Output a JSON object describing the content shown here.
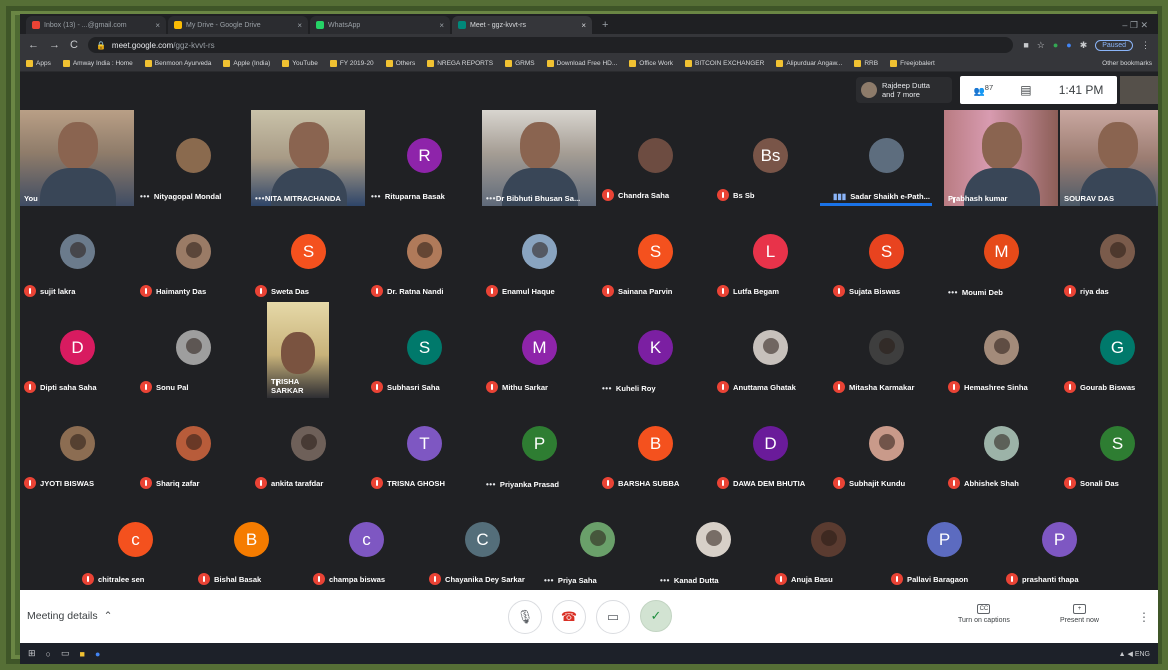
{
  "browser": {
    "tabs": [
      {
        "label": "Inbox (13) - ...@gmail.com",
        "color": "#ea4335"
      },
      {
        "label": "My Drive - Google Drive",
        "color": "#fbbc04"
      },
      {
        "label": "WhatsApp",
        "color": "#25d366"
      },
      {
        "label": "Meet - ggz-kvvt-rs",
        "color": "#00897b"
      }
    ],
    "url_host": "meet.google.com",
    "url_path": "/ggz-kvvt-rs",
    "profile_state": "Paused",
    "bookmarks": [
      "Apps",
      "Amway India : Home",
      "Benmoon Ayurveda",
      "Apple (India)",
      "YouTube",
      "FY 2019-20",
      "Others",
      "NREGA REPORTS",
      "GRMS",
      "Download Free HD...",
      "Office Work",
      "BITCOIN EXCHANGER",
      "Alipurduar Angaw...",
      "RRB",
      "Freejobalert"
    ],
    "other_bookmarks": "Other bookmarks"
  },
  "meet": {
    "presenter_line1": "Rajdeep Dutta",
    "presenter_line2": "and 7 more",
    "participant_count": "87",
    "time": "1:41 PM",
    "meeting_details_label": "Meeting details",
    "captions_label": "Turn on captions",
    "present_label": "Present now"
  },
  "participants_video_row": [
    {
      "name": "You",
      "status": "none"
    },
    {
      "name": "Nityagopal Mondal",
      "status": "dots",
      "avatar_letter": "",
      "avatar_color": "#8a6a4e"
    },
    {
      "name": "NITA MITRACHANDA",
      "status": "dots"
    },
    {
      "name": "Rituparna Basak",
      "status": "dots",
      "avatar_letter": "R",
      "avatar_color": "#8e24aa"
    },
    {
      "name": "Dr Bibhuti Bhusan Sa...",
      "status": "dots"
    },
    {
      "name": "Chandra Saha",
      "status": "muted",
      "avatar_letter": "",
      "avatar_color": "#6d4c41"
    },
    {
      "name": "Bs Sb",
      "status": "muted",
      "avatar_letter": "Bs",
      "avatar_color": "#795548"
    },
    {
      "name": "Sadar Shaikh e-Path...",
      "status": "speaking",
      "avatar_letter": "",
      "avatar_color": "#5d6d7e"
    },
    {
      "name": "Prabhash kumar",
      "status": "muted"
    },
    {
      "name": "SOURAV DAS",
      "status": "none"
    }
  ],
  "participants_rows": [
    [
      {
        "name": "sujit lakra",
        "status": "muted",
        "letter": "",
        "color": "#6b7b8c"
      },
      {
        "name": "Haimanty Das",
        "status": "muted",
        "letter": "",
        "color": "#9a7b66"
      },
      {
        "name": "Sweta Das",
        "status": "muted",
        "letter": "S",
        "color": "#f4511e"
      },
      {
        "name": "Dr. Ratna Nandi",
        "status": "muted",
        "letter": "",
        "color": "#b07a5a"
      },
      {
        "name": "Enamul Haque",
        "status": "muted",
        "letter": "",
        "color": "#89a4c0"
      },
      {
        "name": "Sainana Parvin",
        "status": "muted",
        "letter": "S",
        "color": "#f4511e"
      },
      {
        "name": "Lutfa Begam",
        "status": "muted",
        "letter": "L",
        "color": "#e8334a"
      },
      {
        "name": "Sujata Biswas",
        "status": "muted",
        "letter": "S",
        "color": "#e8431f"
      },
      {
        "name": "Moumi Deb",
        "status": "dots",
        "letter": "M",
        "color": "#e64a19"
      },
      {
        "name": "riya das",
        "status": "muted",
        "letter": "",
        "color": "#7a5b4b"
      }
    ],
    [
      {
        "name": "Dipti saha Saha",
        "status": "muted",
        "letter": "D",
        "color": "#d81b60"
      },
      {
        "name": "Sonu Pal",
        "status": "muted",
        "letter": "",
        "color": "#9e9e9e"
      },
      {
        "name": "TRISHA SARKAR",
        "status": "muted",
        "letter": "",
        "color": "#a08a6a"
      },
      {
        "name": "Subhasri Saha",
        "status": "muted",
        "letter": "S",
        "color": "#00796b"
      },
      {
        "name": "Mithu Sarkar",
        "status": "muted",
        "letter": "M",
        "color": "#8e24aa"
      },
      {
        "name": "Kuheli Roy",
        "status": "dots",
        "letter": "K",
        "color": "#7b1fa2"
      },
      {
        "name": "Anuttama Ghatak",
        "status": "muted",
        "letter": "",
        "color": "#c7c1bc"
      },
      {
        "name": "Mitasha Karmakar",
        "status": "muted",
        "letter": "",
        "color": "#3e3e3e"
      },
      {
        "name": "Hemashree Sinha",
        "status": "muted",
        "letter": "",
        "color": "#a38b7a"
      },
      {
        "name": "Gourab Biswas",
        "status": "muted",
        "letter": "G",
        "color": "#00796b"
      }
    ],
    [
      {
        "name": "JYOTI BISWAS",
        "status": "muted",
        "letter": "",
        "color": "#8c6d52"
      },
      {
        "name": "Shariq zafar",
        "status": "muted",
        "letter": "",
        "color": "#b85c3a"
      },
      {
        "name": "ankita tarafdar",
        "status": "muted",
        "letter": "",
        "color": "#6e6059"
      },
      {
        "name": "TRISNA GHOSH",
        "status": "muted",
        "letter": "T",
        "color": "#7e57c2"
      },
      {
        "name": "Priyanka Prasad",
        "status": "dots",
        "letter": "P",
        "color": "#2e7d32"
      },
      {
        "name": "BARSHA SUBBA",
        "status": "muted",
        "letter": "B",
        "color": "#f4511e"
      },
      {
        "name": "DAWA DEM BHUTIA",
        "status": "muted",
        "letter": "D",
        "color": "#6a1b9a"
      },
      {
        "name": "Subhajit Kundu",
        "status": "muted",
        "letter": "",
        "color": "#c99a8a"
      },
      {
        "name": "Abhishek Shah",
        "status": "muted",
        "letter": "",
        "color": "#9cb3a8"
      },
      {
        "name": "Sonali Das",
        "status": "muted",
        "letter": "S",
        "color": "#2e7d32"
      }
    ],
    [
      {
        "name": "chitralee sen",
        "status": "muted",
        "letter": "c",
        "color": "#f4511e"
      },
      {
        "name": "Bishal Basak",
        "status": "muted",
        "letter": "B",
        "color": "#f57c00"
      },
      {
        "name": "champa biswas",
        "status": "muted",
        "letter": "c",
        "color": "#7e57c2"
      },
      {
        "name": "Chayanika Dey Sarkar",
        "status": "muted",
        "letter": "C",
        "color": "#546e7a"
      },
      {
        "name": "Priya Saha",
        "status": "dots",
        "letter": "",
        "color": "#6aa06a"
      },
      {
        "name": "Kanad Dutta",
        "status": "dots",
        "letter": "",
        "color": "#d7d0c8"
      },
      {
        "name": "Anuja Basu",
        "status": "muted",
        "letter": "",
        "color": "#5a3b30"
      },
      {
        "name": "Pallavi Baragaon",
        "status": "muted",
        "letter": "P",
        "color": "#5c6bc0"
      },
      {
        "name": "prashanti thapa",
        "status": "muted",
        "letter": "P",
        "color": "#7e57c2"
      }
    ]
  ]
}
